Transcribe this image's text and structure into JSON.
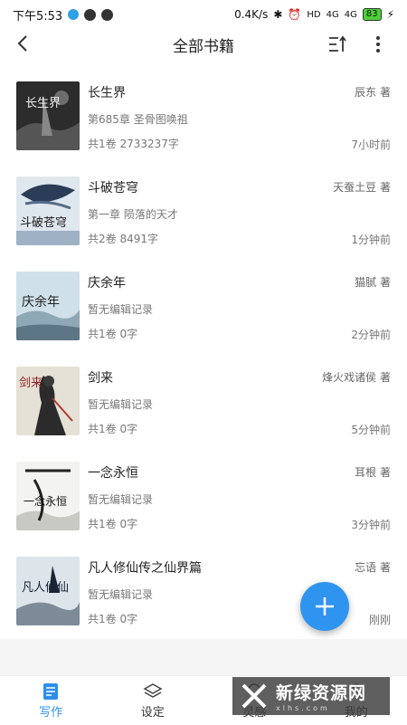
{
  "status_bar": {
    "time": "下午5:53",
    "speed": "0.4K/s",
    "network_badge": "HD",
    "signal_1": "4G",
    "signal_2": "4G",
    "battery": "83"
  },
  "header": {
    "title": "全部书籍",
    "back_icon": "back-arrow-icon",
    "sort_icon": "sort-icon",
    "more_icon": "more-vertical-icon"
  },
  "books": [
    {
      "title": "长生界",
      "author": "辰东 著",
      "chapter": "第685章 圣骨图唤祖",
      "stats": "共1卷 2733237字",
      "time": "7小时前",
      "cover_text": "长生界"
    },
    {
      "title": "斗破苍穹",
      "author": "天蚕土豆 著",
      "chapter": "第一章 陨落的天才",
      "stats": "共2卷 8491字",
      "time": "1分钟前",
      "cover_text": "斗破苍穹"
    },
    {
      "title": "庆余年",
      "author": "猫腻 著",
      "chapter": "暂无编辑记录",
      "stats": "共1卷 0字",
      "time": "2分钟前",
      "cover_text": "庆余年"
    },
    {
      "title": "剑来",
      "author": "烽火戏诸侯 著",
      "chapter": "暂无编辑记录",
      "stats": "共1卷 0字",
      "time": "5分钟前",
      "cover_text": "剑来"
    },
    {
      "title": "一念永恒",
      "author": "耳根 著",
      "chapter": "暂无编辑记录",
      "stats": "共1卷 0字",
      "time": "3分钟前",
      "cover_text": "一念永恒"
    },
    {
      "title": "凡人修仙传之仙界篇",
      "author": "忘语 著",
      "chapter": "暂无编辑记录",
      "stats": "共1卷 0字",
      "time": "刚刚",
      "cover_text": "凡人修仙"
    }
  ],
  "fab": {
    "icon": "plus-icon"
  },
  "tabs": [
    {
      "label": "写作",
      "icon": "write-icon",
      "active": true
    },
    {
      "label": "设定",
      "icon": "layers-icon",
      "active": false
    },
    {
      "label": "灵感",
      "icon": "bulb-icon",
      "active": false
    },
    {
      "label": "我的",
      "icon": "user-icon",
      "active": false
    }
  ],
  "watermark": {
    "title": "新绿资源网",
    "subtitle": "xlhs.com"
  },
  "colors": {
    "accent": "#2e8fe8",
    "fab": "#2e94f0"
  }
}
